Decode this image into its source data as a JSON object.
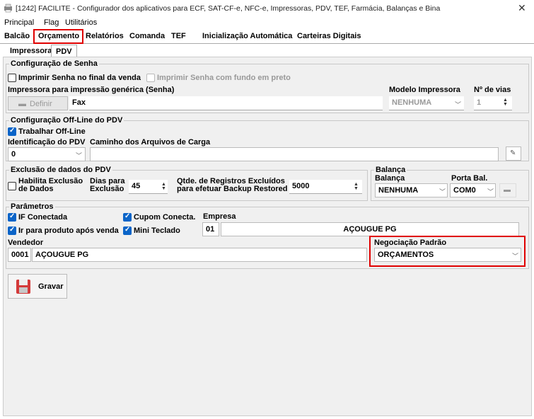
{
  "window": {
    "title": "[1242] FACILITE - Configurador dos aplicativos para ECF, SAT-CF-e, NFC-e, Impressoras, PDV, TEF, Farmácia, Balanças e Bina",
    "close": "✕"
  },
  "menu": [
    "Principal",
    "Flag",
    "Utilitários"
  ],
  "tabs": [
    "Balcão",
    "Orçamento",
    "Relatórios",
    "Comanda",
    "TEF",
    "Inicialização Automática",
    "Carteiras Digitais"
  ],
  "subtabs": [
    "Impressora",
    "PDV"
  ],
  "senha": {
    "group_label": "Configuração de Senha",
    "print_end": "Imprimir Senha no final da venda",
    "print_bg": "Imprimir Senha com fundo em preto",
    "printer_label": "Impressora para impressão genérica (Senha)",
    "define_button": "Definir",
    "printer_value": "Fax",
    "model_label": "Modelo Impressora",
    "model_value": "NENHUMA",
    "copies_label": "Nº de vias",
    "copies_value": "1"
  },
  "offline": {
    "group_label": "Configuração Off-Line do PDV",
    "work_offline": "Trabalhar Off-Line",
    "pdv_id_label": "Identificação do PDV",
    "pdv_id_value": "0",
    "path_label": "Caminho dos Arquivos de Carga",
    "path_value": ""
  },
  "exclusao": {
    "group_label": "Exclusão de dados do PDV",
    "enable_label": "Habilita Exclusão de Dados",
    "days_label": "Dias para Exclusão",
    "days_value": "45",
    "qty_label": "Qtde. de Registros Excluídos para efetuar Backup Restored",
    "qty_value": "5000"
  },
  "balanca": {
    "group_label": "Balança",
    "scale_label": "Balança",
    "scale_value": "NENHUMA",
    "port_label": "Porta Bal.",
    "port_value": "COM0"
  },
  "parametros": {
    "group_label": "Parâmetros",
    "if_conectada": "IF Conectada",
    "cupom_conecta": "Cupom Conecta.",
    "ir_produto": "Ir para produto após venda",
    "mini_teclado": "Mini Teclado",
    "empresa_label": "Empresa",
    "empresa_code": "01",
    "empresa_name": "AÇOUGUE PG",
    "vendedor_label": "Vendedor",
    "vendedor_code": "0001",
    "vendedor_name": "AÇOUGUE PG",
    "negociacao_label": "Negociação Padrão",
    "negociacao_value": "ORÇAMENTOS"
  },
  "save_button": "Gravar",
  "colors": {
    "highlight": "#e00000",
    "checkbox_on": "#0a64c8",
    "panel_bg": "#f0f0f0"
  }
}
